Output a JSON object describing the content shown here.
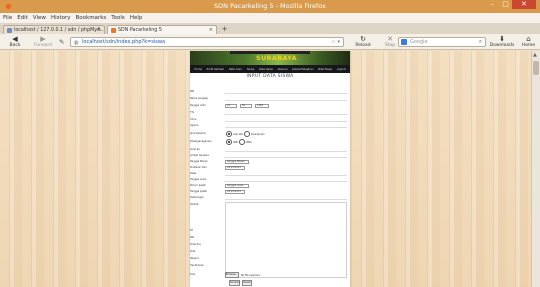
{
  "window": {
    "title": "SDN Pacarkeling 5 - Mozilla Firefox",
    "min_glyph": "–",
    "max_glyph": "□",
    "close_glyph": "✕"
  },
  "menu": [
    "File",
    "Edit",
    "View",
    "History",
    "Bookmarks",
    "Tools",
    "Help"
  ],
  "tabs": [
    {
      "label": "localhost / 127.0.0.1 / sdn / phpMyA...",
      "close": "×"
    },
    {
      "label": "SDN Pacarkeling 5",
      "close": "×"
    }
  ],
  "new_tab": "+",
  "nav": {
    "back": "Back",
    "forward": "Forward",
    "url": "localhost/sdn/index.php?k=siswa",
    "reload": "Reload",
    "stop": "Stop",
    "search_placeholder": "Google",
    "downloads": "Downloads",
    "home": "Home"
  },
  "site": {
    "logo": "SURABAYA",
    "menu": [
      "Home",
      "Profil Sekolah",
      "Data Guru",
      "Siswa",
      "Data Kelas",
      "Absensi",
      "Jadwal Pelajaran",
      "Nilai Siswa",
      "Logout"
    ],
    "form_title": "INPUT DATA SISWA"
  },
  "form": {
    "labels": {
      "nis": "NIS",
      "nama": "Nama Lengkap",
      "ttl": "Tanggal Lahir",
      "tempat": "TTL",
      "umur": "Umur",
      "agama": "Agama",
      "jk": "Jenis Kelamin",
      "warga": "Kewarganegaraan",
      "anak": "Anak Ke",
      "saudara": "Jumlah Saudara",
      "masuk": "Tanggal Masuk",
      "pindah": "Pindahan Dari",
      "kelas": "Kelas",
      "lulus": "Tanggal Lulus",
      "no_ijazah": "Nomor Ijazah",
      "tgl_ijazah": "Tanggal Ijazah",
      "ket": "Keterangan",
      "alamat": "Alamat",
      "rt": "RT",
      "rw": "RW",
      "kodepos": "Kode Pos",
      "kota": "Kota",
      "telp": "Telepon",
      "hp": "Handphone",
      "foto": "Foto"
    },
    "date_values": {
      "day": "01",
      "month": "01",
      "year": "1990"
    },
    "jk_options": [
      "Laki-laki",
      "Perempuan"
    ],
    "warga_options": [
      "WNI",
      "WNA"
    ],
    "masuk_value": "Tanggal Masuk",
    "pindah_value": "01/01/2013",
    "lulus_value": "Tanggal Lulus",
    "ijazah_value": "01/01/2013",
    "browse": "Browse...",
    "no_file": "No file selected.",
    "submit": "Simpan",
    "reset": "Reset"
  }
}
